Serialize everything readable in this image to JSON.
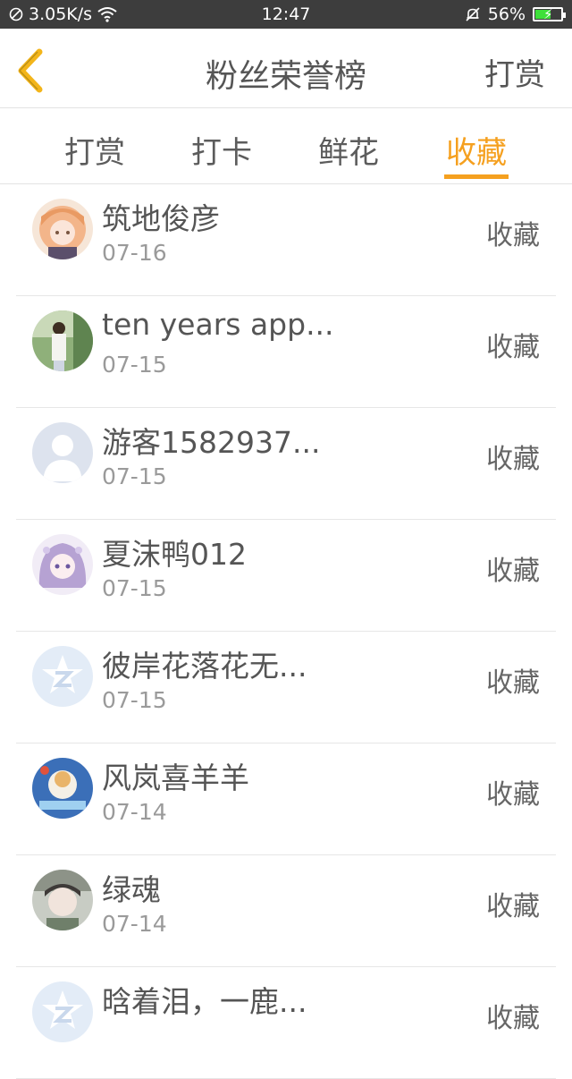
{
  "status_bar": {
    "speed": "3.05K/s",
    "time": "12:47",
    "battery": "56%",
    "battery_level": 0.56
  },
  "header": {
    "title": "粉丝荣誉榜",
    "action": "打赏"
  },
  "tabs": [
    {
      "label": "打赏",
      "active": false
    },
    {
      "label": "打卡",
      "active": false
    },
    {
      "label": "鲜花",
      "active": false
    },
    {
      "label": "收藏",
      "active": true
    }
  ],
  "list": [
    {
      "name": "筑地俊彦",
      "date": "07-16",
      "action": "收藏",
      "avatar": "anime-girl-orange"
    },
    {
      "name": "ten years app...",
      "date": "07-15",
      "action": "收藏",
      "avatar": "photo-green"
    },
    {
      "name": "游客1582937...",
      "date": "07-15",
      "action": "收藏",
      "avatar": "default-person"
    },
    {
      "name": "夏沫鸭012",
      "date": "07-15",
      "action": "收藏",
      "avatar": "anime-girl-purple"
    },
    {
      "name": "彼岸花落花无...",
      "date": "07-15",
      "action": "收藏",
      "avatar": "qq-logo"
    },
    {
      "name": "风岚喜羊羊",
      "date": "07-14",
      "action": "收藏",
      "avatar": "anime-blue"
    },
    {
      "name": "绿魂",
      "date": "07-14",
      "action": "收藏",
      "avatar": "photo-grey"
    },
    {
      "name": "晗着泪，一鹿...",
      "date": "",
      "action": "收藏",
      "avatar": "qq-logo"
    }
  ],
  "colors": {
    "accent": "#f5a01f",
    "status_bar": "#3d3d3d",
    "text": "#555555",
    "subtext": "#9a9a9a"
  }
}
